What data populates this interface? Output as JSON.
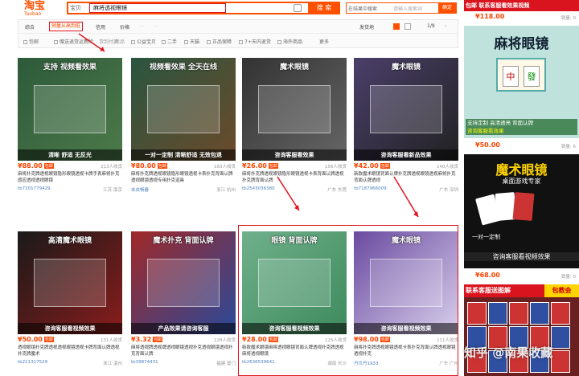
{
  "header": {
    "logo_cn": "淘宝",
    "logo_en": "Taobao",
    "category": "宝贝",
    "query": "麻将透视眼镜",
    "search_btn": "搜 索",
    "search2_left": "在结果中搜索",
    "search2_right": "请输入搜索词",
    "search2_btn": "确定"
  },
  "sort": {
    "items": [
      "综合",
      "销量从高到低",
      "信用",
      "价格",
      "—",
      "—"
    ],
    "right": [
      "发货地",
      "1/9"
    ]
  },
  "filters": [
    "包邮",
    "赠送退货运费险",
    "货到付款",
    "新品",
    "公益宝贝",
    "二手",
    "天猫",
    "正品保障",
    "7+天内退货",
    "海外商品",
    "更多"
  ],
  "products": [
    {
      "price": "¥88.00",
      "tag": "包邮",
      "sold": "213人收货",
      "title": "麻将扑克牌透视眼镜隐形眼镜透视卡牌手表麻将扑克感应透视透视眼镜",
      "shop": "tb7201779429",
      "loc": "江苏 南京",
      "img_top": "支持 视频看效果",
      "img_bot": "清晰 舒适 无反光",
      "colors": [
        "#2d5a3a",
        "#4d7a4a"
      ]
    },
    {
      "price": "¥80.00",
      "tag": "包邮",
      "sold": "183人收货",
      "title": "麻将扑克牌透视眼镜隐形眼镜透视卡表扑克背面认牌透视眼镜透视专用扑克道具",
      "shop": "未央畅春",
      "loc": "浙江 杭州",
      "img_top": "视频看效果 全天在线",
      "img_bot": "一对一定制 清晰舒适 无效包退",
      "colors": [
        "#2a5540",
        "#6b4a2a"
      ]
    },
    {
      "price": "¥26.00",
      "tag": "包邮",
      "sold": "156人收货",
      "title": "麻将扑克牌透视眼镜隐形眼镜透视卡表背面认牌透视扑克牌背面认牌",
      "shop": "tb2543036380",
      "loc": "广东 东莞",
      "img_top": "魔术眼镜",
      "img_bot": "咨询客服看效果",
      "colors": [
        "#333",
        "#666"
      ]
    },
    {
      "price": "¥42.00",
      "tag": "包邮",
      "sold": "140人收货",
      "title": "新款魔术眼镜背面认牌扑克牌透视眼镜透视麻将扑克背面认牌透视",
      "shop": "tb7187966009",
      "loc": "广东 深圳",
      "img_top": "魔术眼镜",
      "img_bot": "咨询客服看新品效果",
      "colors": [
        "#4a3f6a",
        "#222"
      ]
    },
    {
      "price": "¥50.00",
      "tag": "包邮",
      "sold": "131人收货",
      "title": "透视眼镜扑克牌透视透视眼镜透视卡牌背面认牌透视扑克牌魔术",
      "shop": "tb211317529",
      "loc": "浙江 温州",
      "img_top": "高清魔术眼镜",
      "img_bot": "咨询客服看视频效果",
      "colors": [
        "#1a1a1a",
        "#8a1c1c"
      ]
    },
    {
      "price": "¥3.32",
      "tag": "包邮",
      "sold": "128人收货",
      "title": "麻将透视牌透视牌透视眼镜透视扑克透视眼镜透视扑克背面认牌",
      "shop": "tb39874431",
      "loc": "福建 厦门",
      "img_top": "魔术扑克 背面认牌",
      "img_bot": "产品效果请咨询客服",
      "colors": [
        "#a02828",
        "#2a4a9a"
      ]
    },
    {
      "price": "¥28.00",
      "tag": "包邮",
      "sold": "125人收货",
      "title": "新款魔术眼镜麻将透视眼镜背面认牌透视扑克牌透视麻将透视眼镜",
      "shop": "tb2636539641",
      "loc": "湖南 长沙",
      "img_top": "眼镜 背面认牌",
      "img_bot": "咨询客服看视频效果",
      "colors": [
        "#6fb08a",
        "#3e8a5e"
      ]
    },
    {
      "price": "¥98.00",
      "tag": "包邮",
      "sold": "111人收货",
      "title": "麻将扑克牌透视眼镜透视卡表扑克背面认牌透视眼镜透视扑克",
      "shop": "丹贝丹1933",
      "loc": "广东 广州",
      "img_top": "魔术眼镜",
      "img_bot": "咨询客服看视频效果",
      "colors": [
        "#6a4aa0",
        "#d9d0ec"
      ]
    }
  ],
  "right": {
    "top_label": "包邮 联系客服看效果视频",
    "price1": "¥118.00",
    "banner1": "麻将眼镜",
    "banner1_bot": "支持定制 高清透亮 背面认牌",
    "banner1_bot2": "咨询客服看效果",
    "price2": "¥50.00",
    "sold2": "销量: 6",
    "banner2": "魔术眼镜",
    "banner2_sub": "桌面游戏专家",
    "banner2_bot": "一对一定制",
    "banner2_bot2": "咨询客服看视频效果",
    "price3": "¥68.00",
    "sold3": "销量: 0",
    "banner3": "联系客服送图解",
    "banner3_tag": "包教会",
    "sold1": "销量: 0"
  },
  "watermark": "知乎 @南果收藏",
  "colors": {
    "accent": "#ff5000",
    "price": "#ff4400",
    "annotation": "#e0141e"
  }
}
